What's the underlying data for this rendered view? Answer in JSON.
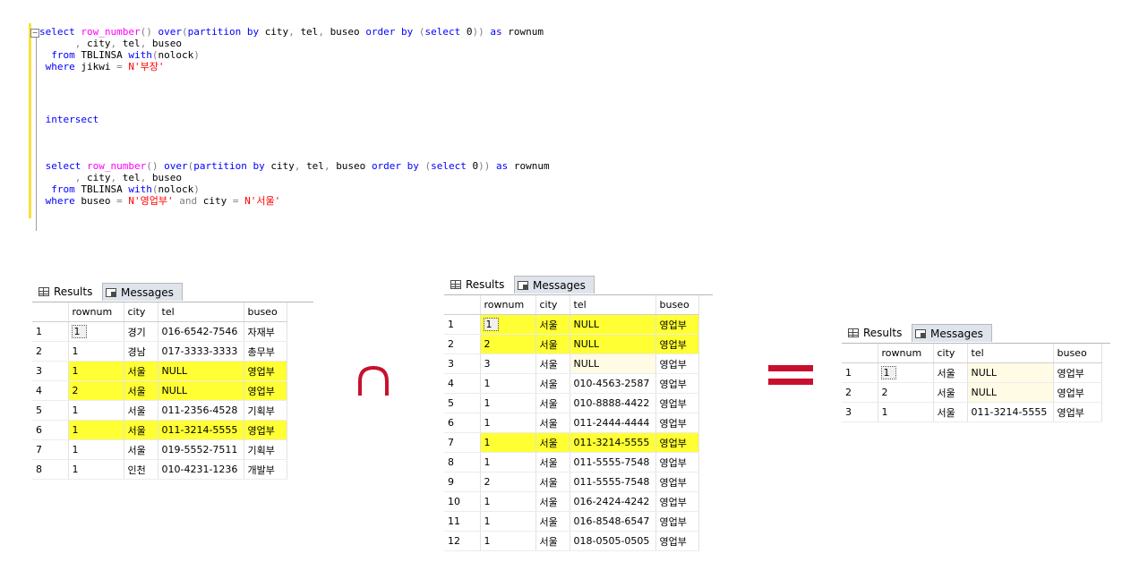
{
  "editor": {
    "lines": [
      {
        "parts": [
          [
            "kw",
            "select "
          ],
          [
            "fn",
            "row_number"
          ],
          [
            "gr",
            "() "
          ],
          [
            "kw",
            "over"
          ],
          [
            "gr",
            "("
          ],
          [
            "kw",
            "partition by "
          ],
          [
            "",
            "city"
          ],
          [
            "gr",
            ", "
          ],
          [
            "",
            "tel"
          ],
          [
            "gr",
            ", "
          ],
          [
            "",
            "buseo "
          ],
          [
            "kw",
            "order by "
          ],
          [
            "gr",
            "("
          ],
          [
            "kw",
            "select "
          ],
          [
            "",
            "0"
          ],
          [
            "gr",
            "))"
          ],
          [
            "kw",
            " as "
          ],
          [
            "",
            "rownum"
          ]
        ]
      },
      {
        "parts": [
          [
            "gr",
            "      , "
          ],
          [
            "",
            "city"
          ],
          [
            "gr",
            ", "
          ],
          [
            "",
            "tel"
          ],
          [
            "gr",
            ", "
          ],
          [
            "",
            "buseo"
          ]
        ]
      },
      {
        "parts": [
          [
            "kw",
            "  from "
          ],
          [
            "",
            "TBLINSA "
          ],
          [
            "kw",
            "with"
          ],
          [
            "gr",
            "("
          ],
          [
            "",
            "nolock"
          ],
          [
            "gr",
            ")"
          ]
        ]
      },
      {
        "parts": [
          [
            "kw",
            " where "
          ],
          [
            "",
            "jikwi "
          ],
          [
            "gr",
            "= "
          ],
          [
            "str",
            "N'부장'"
          ]
        ]
      },
      {
        "parts": []
      },
      {
        "parts": []
      },
      {
        "parts": [
          [
            "kw",
            " intersect"
          ]
        ]
      },
      {
        "parts": []
      },
      {
        "parts": []
      },
      {
        "parts": [
          [
            "kw",
            " select "
          ],
          [
            "fn",
            "row_number"
          ],
          [
            "gr",
            "() "
          ],
          [
            "kw",
            "over"
          ],
          [
            "gr",
            "("
          ],
          [
            "kw",
            "partition by "
          ],
          [
            "",
            "city"
          ],
          [
            "gr",
            ", "
          ],
          [
            "",
            "tel"
          ],
          [
            "gr",
            ", "
          ],
          [
            "",
            "buseo "
          ],
          [
            "kw",
            "order by "
          ],
          [
            "gr",
            "("
          ],
          [
            "kw",
            "select "
          ],
          [
            "",
            "0"
          ],
          [
            "gr",
            "))"
          ],
          [
            "kw",
            " as "
          ],
          [
            "",
            "rownum"
          ]
        ]
      },
      {
        "parts": [
          [
            "gr",
            "      , "
          ],
          [
            "",
            "city"
          ],
          [
            "gr",
            ", "
          ],
          [
            "",
            "tel"
          ],
          [
            "gr",
            ", "
          ],
          [
            "",
            "buseo"
          ]
        ]
      },
      {
        "parts": [
          [
            "kw",
            "  from "
          ],
          [
            "",
            "TBLINSA "
          ],
          [
            "kw",
            "with"
          ],
          [
            "gr",
            "("
          ],
          [
            "",
            "nolock"
          ],
          [
            "gr",
            ")"
          ]
        ]
      },
      {
        "parts": [
          [
            "kw",
            " where "
          ],
          [
            "",
            "buseo "
          ],
          [
            "gr",
            "= "
          ],
          [
            "str",
            "N'영업부' "
          ],
          [
            "gr",
            "and "
          ],
          [
            "",
            "city "
          ],
          [
            "gr",
            "= "
          ],
          [
            "str",
            "N'서울'"
          ]
        ]
      }
    ]
  },
  "tabs": {
    "results": "Results",
    "messages": "Messages"
  },
  "columns": [
    "rownum",
    "city",
    "tel",
    "buseo"
  ],
  "grid1": {
    "rows": [
      {
        "n": "1",
        "v": [
          "1",
          "경기",
          "016-6542-7546",
          "자재부"
        ],
        "hl": false
      },
      {
        "n": "2",
        "v": [
          "1",
          "경남",
          "017-3333-3333",
          "총무부"
        ],
        "hl": false
      },
      {
        "n": "3",
        "v": [
          "1",
          "서울",
          "NULL",
          "영업부"
        ],
        "hl": true
      },
      {
        "n": "4",
        "v": [
          "2",
          "서울",
          "NULL",
          "영업부"
        ],
        "hl": true
      },
      {
        "n": "5",
        "v": [
          "1",
          "서울",
          "011-2356-4528",
          "기획부"
        ],
        "hl": false
      },
      {
        "n": "6",
        "v": [
          "1",
          "서울",
          "011-3214-5555",
          "영업부"
        ],
        "hl": true
      },
      {
        "n": "7",
        "v": [
          "1",
          "서울",
          "019-5552-7511",
          "기획부"
        ],
        "hl": false
      },
      {
        "n": "8",
        "v": [
          "1",
          "인천",
          "010-4231-1236",
          "개발부"
        ],
        "hl": false
      }
    ]
  },
  "grid2": {
    "rows": [
      {
        "n": "1",
        "v": [
          "1",
          "서울",
          "NULL",
          "영업부"
        ],
        "hl": true
      },
      {
        "n": "2",
        "v": [
          "2",
          "서울",
          "NULL",
          "영업부"
        ],
        "hl": true
      },
      {
        "n": "3",
        "v": [
          "3",
          "서울",
          "NULL",
          "영업부"
        ],
        "hl": false
      },
      {
        "n": "4",
        "v": [
          "1",
          "서울",
          "010-4563-2587",
          "영업부"
        ],
        "hl": false
      },
      {
        "n": "5",
        "v": [
          "1",
          "서울",
          "010-8888-4422",
          "영업부"
        ],
        "hl": false
      },
      {
        "n": "6",
        "v": [
          "1",
          "서울",
          "011-2444-4444",
          "영업부"
        ],
        "hl": false
      },
      {
        "n": "7",
        "v": [
          "1",
          "서울",
          "011-3214-5555",
          "영업부"
        ],
        "hl": true
      },
      {
        "n": "8",
        "v": [
          "1",
          "서울",
          "011-5555-7548",
          "영업부"
        ],
        "hl": false
      },
      {
        "n": "9",
        "v": [
          "2",
          "서울",
          "011-5555-7548",
          "영업부"
        ],
        "hl": false
      },
      {
        "n": "10",
        "v": [
          "1",
          "서울",
          "016-2424-4242",
          "영업부"
        ],
        "hl": false
      },
      {
        "n": "11",
        "v": [
          "1",
          "서울",
          "016-8548-6547",
          "영업부"
        ],
        "hl": false
      },
      {
        "n": "12",
        "v": [
          "1",
          "서울",
          "018-0505-0505",
          "영업부"
        ],
        "hl": false
      }
    ]
  },
  "grid3": {
    "rows": [
      {
        "n": "1",
        "v": [
          "1",
          "서울",
          "NULL",
          "영업부"
        ],
        "hl": false
      },
      {
        "n": "2",
        "v": [
          "2",
          "서울",
          "NULL",
          "영업부"
        ],
        "hl": false
      },
      {
        "n": "3",
        "v": [
          "1",
          "서울",
          "011-3214-5555",
          "영업부"
        ],
        "hl": false
      }
    ]
  },
  "operators": {
    "intersect_symbol": "∩",
    "equals_symbol": "=",
    "highlight_color": "#ffff33",
    "operator_color": "#c8102e"
  }
}
